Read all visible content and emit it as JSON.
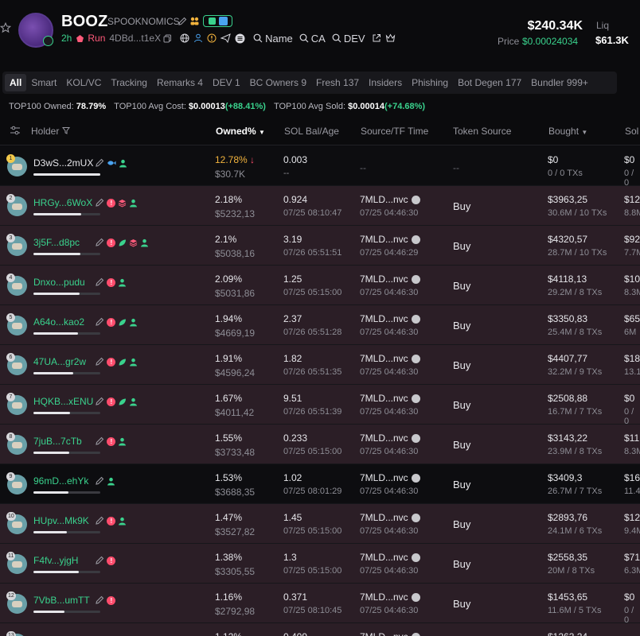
{
  "token": {
    "symbol": "BOOZ",
    "name": "SPOOKNOMICS",
    "age": "2h",
    "status": "Run",
    "contract": "4DBd...t1eX",
    "links": [
      "Name",
      "CA",
      "DEV"
    ],
    "market_cap": "$240.34K",
    "price_label": "Price",
    "price": "$0.00024034",
    "liq_label": "Liq",
    "liq": "$61.3K"
  },
  "tabs": [
    "All",
    "Smart",
    "KOL/VC",
    "Tracking",
    "Remarks 4",
    "DEV 1",
    "BC Owners 9",
    "Fresh 137",
    "Insiders",
    "Phishing",
    "Bot Degen 177",
    "Bundler 999+"
  ],
  "stats": {
    "owned_label": "TOP100 Owned:",
    "owned": "78.79%",
    "avg_cost_label": "TOP100 Avg Cost:",
    "avg_cost": "$0.00013",
    "avg_cost_change": "(+88.41%)",
    "avg_sold_label": "TOP100 Avg Sold:",
    "avg_sold": "$0.00014",
    "avg_sold_change": "(+74.68%)"
  },
  "columns": {
    "holder": "Holder",
    "owned": "Owned%",
    "sol": "SOL Bal/Age",
    "source": "Source/TF Time",
    "token_source": "Token Source",
    "bought": "Bought",
    "sold": "Sol"
  },
  "colors": {
    "green": "#3ad28d",
    "red": "#ff4d6d",
    "pink_row": "#2b1e26",
    "accent_yellow": "#f2b33d"
  },
  "rows": [
    {
      "rank": "1",
      "address": "D3wS...2mUX",
      "tags": [
        "edit-icon",
        "fish-icon",
        "user-icon"
      ],
      "bar": 1.0,
      "owned": "12.78%",
      "owned_value": "$30.7K",
      "sol": "0.003",
      "sol_age": "--",
      "source": "--",
      "source_time": "",
      "token_source": "--",
      "bought": "$0",
      "bought_sub": "0 / 0 TXs",
      "sold": "$0",
      "sold_sub": "0 / 0",
      "pink": false
    },
    {
      "rank": "2",
      "address": "HRGy...6WoX",
      "tags": [
        "edit-icon",
        "warn-icon",
        "stack-icon",
        "user-icon"
      ],
      "bar": 0.72,
      "owned": "2.18%",
      "owned_value": "$5232,13",
      "sol": "0.924",
      "sol_age": "07/25 08:10:47",
      "source": "7MLD...nvc",
      "source_time": "07/25 04:46:30",
      "token_source": "Buy",
      "bought": "$3963,25",
      "bought_sub": "30.6M / 10 TXs",
      "sold": "$12",
      "sold_sub": "8.8M",
      "pink": true
    },
    {
      "rank": "3",
      "address": "3j5F...d8pc",
      "tags": [
        "edit-icon",
        "warn-icon",
        "leaf-icon",
        "stack-icon",
        "user-icon"
      ],
      "bar": 0.7,
      "owned": "2.1%",
      "owned_value": "$5038,16",
      "sol": "3.19",
      "sol_age": "07/26 05:51:51",
      "source": "7MLD...nvc",
      "source_time": "07/25 04:46:29",
      "token_source": "Buy",
      "bought": "$4320,57",
      "bought_sub": "28.7M / 10 TXs",
      "sold": "$92",
      "sold_sub": "7.7M",
      "pink": true
    },
    {
      "rank": "4",
      "address": "Dnxo...pudu",
      "tags": [
        "edit-icon",
        "warn-icon",
        "user-icon"
      ],
      "bar": 0.69,
      "owned": "2.09%",
      "owned_value": "$5031,86",
      "sol": "1.25",
      "sol_age": "07/25 05:15:00",
      "source": "7MLD...nvc",
      "source_time": "07/25 04:46:30",
      "token_source": "Buy",
      "bought": "$4118,13",
      "bought_sub": "29.2M / 8 TXs",
      "sold": "$10",
      "sold_sub": "8.3M",
      "pink": true
    },
    {
      "rank": "5",
      "address": "A64o...kao2",
      "tags": [
        "edit-icon",
        "warn-icon",
        "leaf-icon",
        "user-icon"
      ],
      "bar": 0.67,
      "owned": "1.94%",
      "owned_value": "$4669,19",
      "sol": "2.37",
      "sol_age": "07/26 05:51:28",
      "source": "7MLD...nvc",
      "source_time": "07/25 04:46:30",
      "token_source": "Buy",
      "bought": "$3350,83",
      "bought_sub": "25.4M / 8 TXs",
      "sold": "$65",
      "sold_sub": "6M",
      "pink": true
    },
    {
      "rank": "6",
      "address": "47UA...gr2w",
      "tags": [
        "edit-icon",
        "warn-icon",
        "leaf-icon",
        "user-icon"
      ],
      "bar": 0.6,
      "owned": "1.91%",
      "owned_value": "$4596,24",
      "sol": "1.82",
      "sol_age": "07/26 05:51:35",
      "source": "7MLD...nvc",
      "source_time": "07/25 04:46:30",
      "token_source": "Buy",
      "bought": "$4407,77",
      "bought_sub": "32.2M / 9 TXs",
      "sold": "$18",
      "sold_sub": "13.1",
      "pink": true
    },
    {
      "rank": "7",
      "address": "HQKB...xENU",
      "tags": [
        "edit-icon",
        "warn-icon",
        "leaf-icon",
        "user-icon"
      ],
      "bar": 0.55,
      "owned": "1.67%",
      "owned_value": "$4011,42",
      "sol": "9.51",
      "sol_age": "07/26 05:51:39",
      "source": "7MLD...nvc",
      "source_time": "07/25 04:46:30",
      "token_source": "Buy",
      "bought": "$2508,88",
      "bought_sub": "16.7M / 7 TXs",
      "sold": "$0",
      "sold_sub": "0 / 0",
      "pink": true
    },
    {
      "rank": "8",
      "address": "7juB...7cTb",
      "tags": [
        "edit-icon",
        "warn-icon",
        "user-icon"
      ],
      "bar": 0.53,
      "owned": "1.55%",
      "owned_value": "$3733,48",
      "sol": "0.233",
      "sol_age": "07/25 05:15:00",
      "source": "7MLD...nvc",
      "source_time": "07/25 04:46:30",
      "token_source": "Buy",
      "bought": "$3143,22",
      "bought_sub": "23.9M / 8 TXs",
      "sold": "$11",
      "sold_sub": "8.3M",
      "pink": true
    },
    {
      "rank": "9",
      "address": "96mD...ehYk",
      "tags": [
        "edit-icon",
        "user-icon"
      ],
      "bar": 0.52,
      "owned": "1.53%",
      "owned_value": "$3688,35",
      "sol": "1.02",
      "sol_age": "07/25 08:01:29",
      "source": "7MLD...nvc",
      "source_time": "07/25 04:46:30",
      "token_source": "Buy",
      "bought": "$3409,3",
      "bought_sub": "26.7M / 7 TXs",
      "sold": "$16",
      "sold_sub": "11.4",
      "pink": false
    },
    {
      "rank": "10",
      "address": "HUpv...Mk9K",
      "tags": [
        "edit-icon",
        "warn-icon",
        "user-icon"
      ],
      "bar": 0.5,
      "owned": "1.47%",
      "owned_value": "$3527,82",
      "sol": "1.45",
      "sol_age": "07/25 05:15:00",
      "source": "7MLD...nvc",
      "source_time": "07/25 04:46:30",
      "token_source": "Buy",
      "bought": "$2893,76",
      "bought_sub": "24.1M / 6 TXs",
      "sold": "$12",
      "sold_sub": "9.4M",
      "pink": true
    },
    {
      "rank": "11",
      "address": "F4fv...yjgH",
      "tags": [
        "edit-icon",
        "warn-icon"
      ],
      "bar": 0.68,
      "owned": "1.38%",
      "owned_value": "$3305,55",
      "sol": "1.3",
      "sol_age": "07/25 05:15:00",
      "source": "7MLD...nvc",
      "source_time": "07/25 04:46:30",
      "token_source": "Buy",
      "bought": "$2558,35",
      "bought_sub": "20M / 8 TXs",
      "sold": "$71",
      "sold_sub": "6.3M",
      "pink": true
    },
    {
      "rank": "12",
      "address": "7VbB...umTT",
      "tags": [
        "edit-icon",
        "warn-icon"
      ],
      "bar": 0.47,
      "owned": "1.16%",
      "owned_value": "$2792,98",
      "sol": "0.371",
      "sol_age": "07/25 08:10:45",
      "source": "7MLD...nvc",
      "source_time": "07/25 04:46:30",
      "token_source": "Buy",
      "bought": "$1453,65",
      "bought_sub": "11.6M / 5 TXs",
      "sold": "$0",
      "sold_sub": "0 / 0",
      "pink": true
    },
    {
      "rank": "13",
      "address": "",
      "tags": [],
      "bar": 0.45,
      "owned": "1.12%",
      "owned_value": "",
      "sol": "0.409",
      "sol_age": "",
      "source": "7MLD...nvc",
      "source_time": "",
      "token_source": "",
      "bought": "$1263,24",
      "bought_sub": "",
      "sold": "",
      "sold_sub": "",
      "pink": true
    }
  ]
}
